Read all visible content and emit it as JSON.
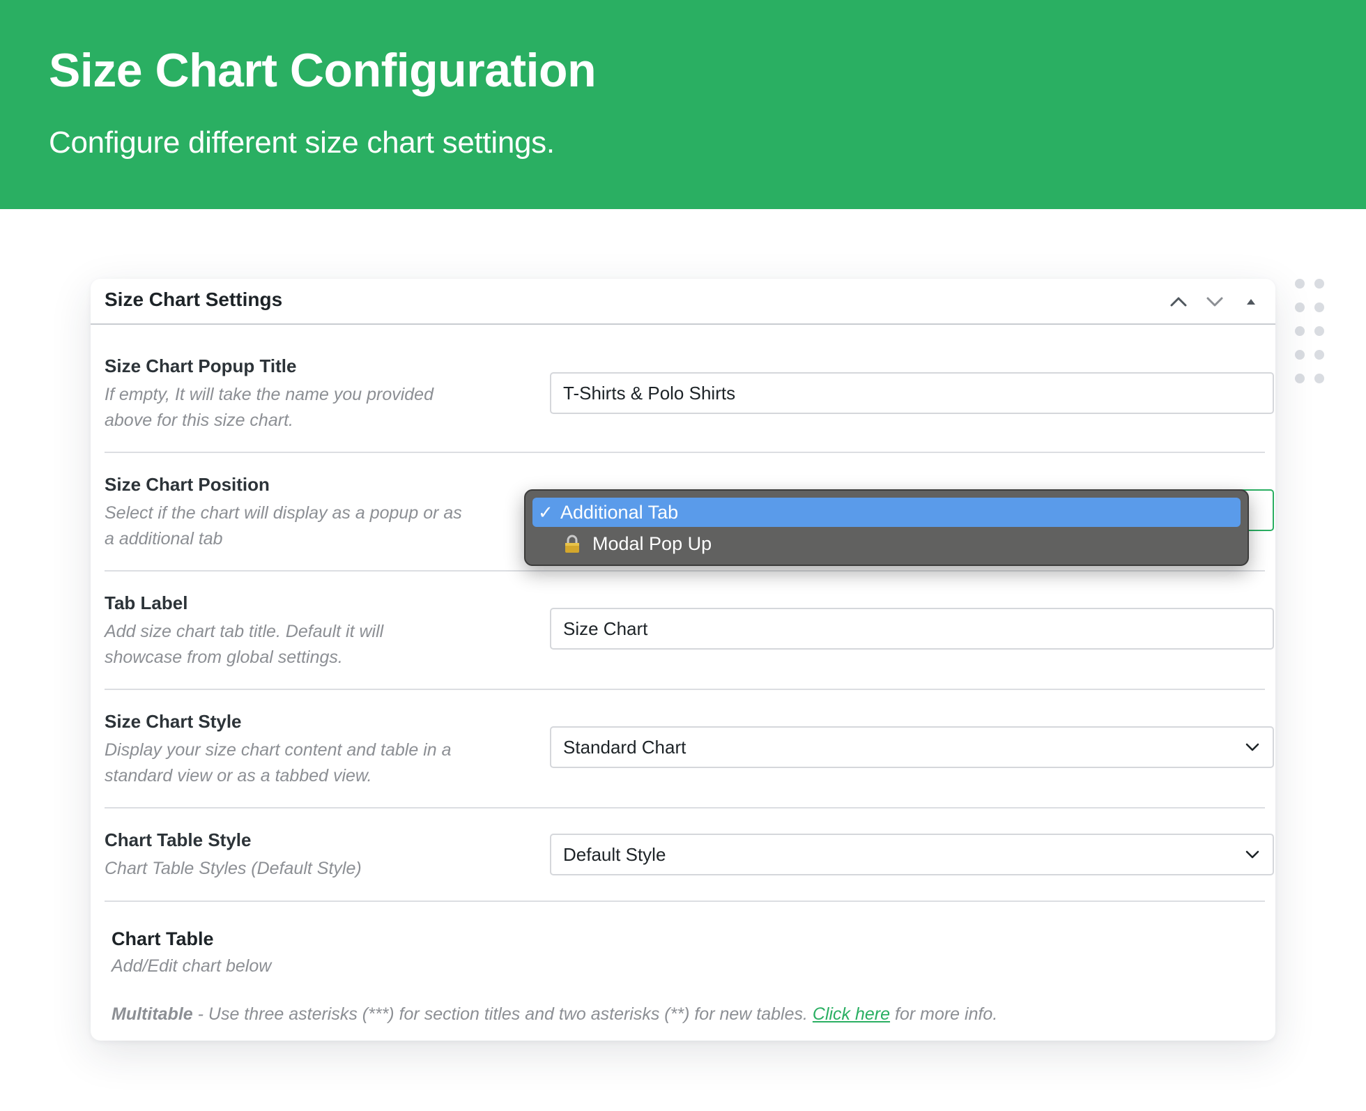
{
  "hero": {
    "title": "Size Chart Configuration",
    "subtitle": "Configure different size chart settings."
  },
  "panel": {
    "title": "Size Chart Settings",
    "icons": [
      "chevron-up-icon",
      "chevron-down-icon",
      "triangle-up-icon"
    ]
  },
  "rows": {
    "popup_title": {
      "label": "Size Chart Popup Title",
      "desc_line1": "If empty, It will take the name you provided",
      "desc_line2": "above for this size chart.",
      "value": "T-Shirts & Polo Shirts"
    },
    "position": {
      "label": "Size Chart Position",
      "desc_line1": "Select if the chart will display as a popup or as",
      "desc_line2": "a additional tab",
      "options": [
        {
          "label": "Additional Tab",
          "selected": true,
          "locked": false
        },
        {
          "label": "Modal Pop Up",
          "selected": false,
          "locked": true
        }
      ]
    },
    "tab_label": {
      "label": "Tab Label",
      "desc_line1": "Add size chart tab title. Default it will",
      "desc_line2": "showcase from global settings.",
      "value": "Size Chart"
    },
    "style": {
      "label": "Size Chart Style",
      "desc_line1": "Display your size chart content and table in a",
      "desc_line2": "standard view or as a tabbed view.",
      "value": "Standard Chart"
    },
    "table_style": {
      "label": "Chart Table Style",
      "desc_line1": "Chart Table Styles (Default Style)",
      "value": "Default Style"
    }
  },
  "chart_table": {
    "label": "Chart Table",
    "desc": "Add/Edit chart below",
    "multitable_bold": "Multitable",
    "multitable_text": " - Use three asterisks (***) for section titles and two asterisks (**) for new tables. ",
    "link_text": "Click here",
    "after_link": " for more info."
  },
  "colors": {
    "brand_green": "#2aaf62",
    "selected_blue": "#5a9bea"
  }
}
